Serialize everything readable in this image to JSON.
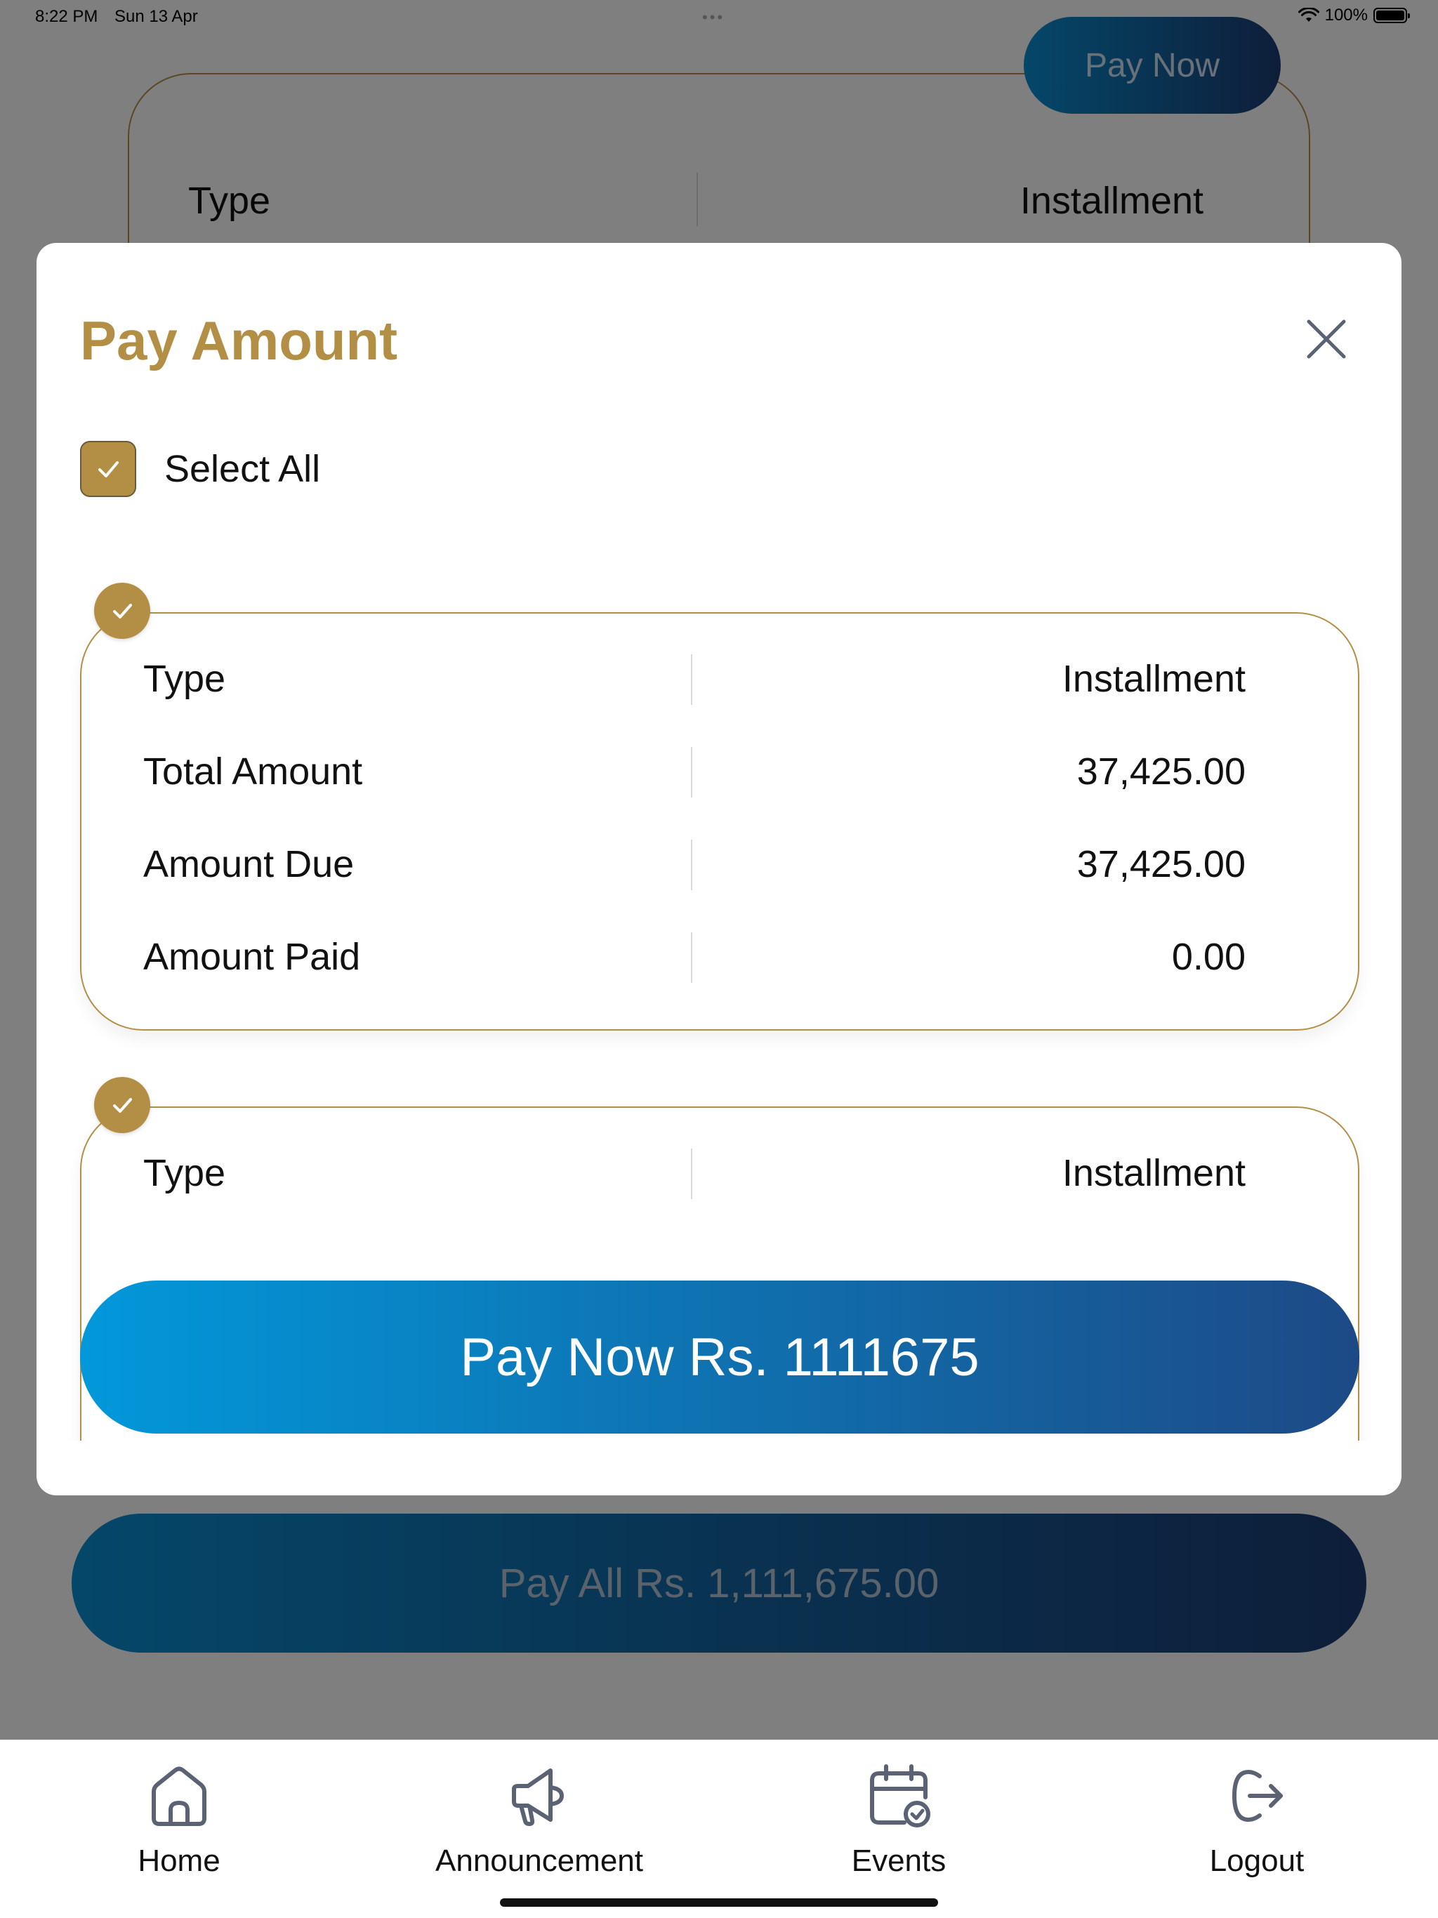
{
  "status_bar": {
    "time": "8:22 PM",
    "date": "Sun 13 Apr",
    "dots": "•••",
    "battery": "100%"
  },
  "background": {
    "pay_now_label": "Pay Now",
    "card_row": {
      "label": "Type",
      "value": "Installment"
    },
    "pay_all_label": "Pay All Rs. 1,111,675.00"
  },
  "modal": {
    "title": "Pay Amount",
    "select_all_label": "Select All",
    "select_all_checked": true,
    "items": [
      {
        "checked": true,
        "rows": [
          {
            "label": "Type",
            "value": "Installment"
          },
          {
            "label": "Total Amount",
            "value": "37,425.00"
          },
          {
            "label": "Amount Due",
            "value": "37,425.00"
          },
          {
            "label": "Amount Paid",
            "value": "0.00"
          }
        ]
      },
      {
        "checked": true,
        "rows": [
          {
            "label": "Type",
            "value": "Installment"
          }
        ]
      }
    ],
    "pay_now_label": "Pay Now Rs. 1111675"
  },
  "tabs": [
    {
      "label": "Home",
      "icon": "home-icon"
    },
    {
      "label": "Announcement",
      "icon": "megaphone-icon"
    },
    {
      "label": "Events",
      "icon": "calendar-check-icon"
    },
    {
      "label": "Logout",
      "icon": "logout-icon"
    }
  ],
  "colors": {
    "accent_gold": "#b38f45",
    "button_gradient_start": "#0298da",
    "button_gradient_end": "#1d4a86",
    "icon_slate": "#5b6273"
  }
}
